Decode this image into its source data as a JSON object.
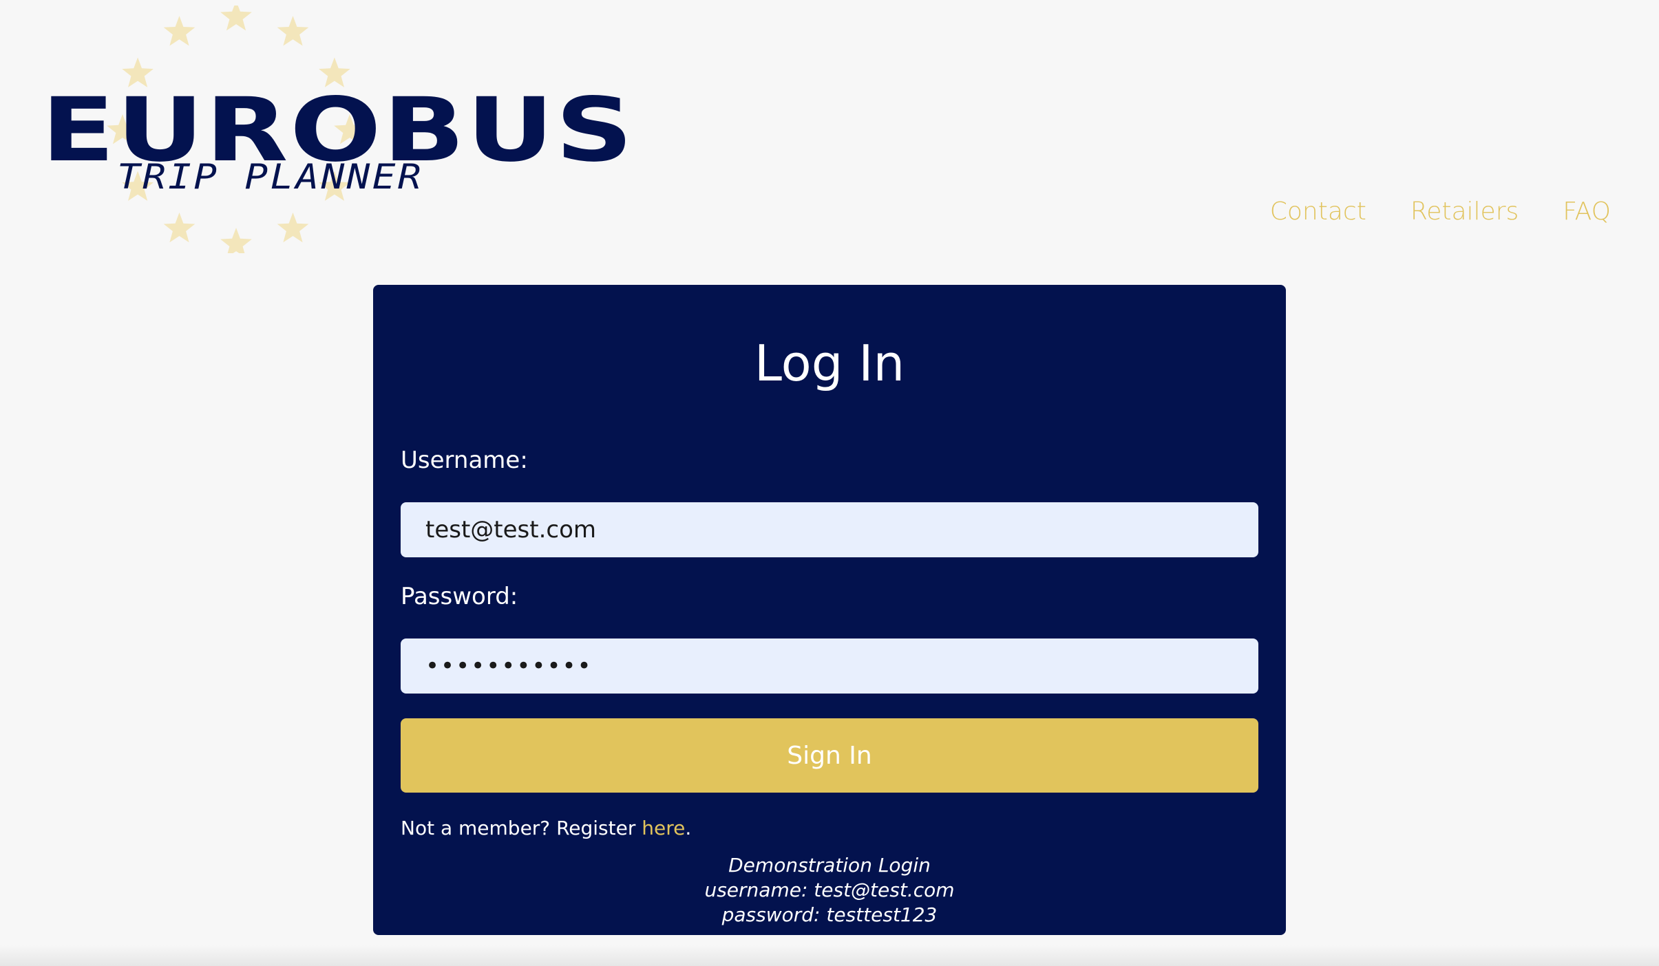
{
  "logo": {
    "title": "EUROBUS",
    "subtitle": "TRIP PLANNER",
    "star_color": "#f3e6bb"
  },
  "nav": {
    "items": [
      {
        "label": "Contact"
      },
      {
        "label": "Retailers"
      },
      {
        "label": "FAQ"
      }
    ],
    "color": "#e1c35c"
  },
  "login": {
    "title": "Log In",
    "username_label": "Username:",
    "username_value": "test@test.com",
    "password_label": "Password:",
    "password_value": "testtest123",
    "signin_label": "Sign In",
    "register_prefix": "Not a member? Register ",
    "register_link": "here",
    "register_suffix": ".",
    "demo_title": "Demonstration Login",
    "demo_username": "username: test@test.com",
    "demo_password": "password: testtest123"
  },
  "colors": {
    "card_bg": "#03124e",
    "accent": "#e1c45c",
    "input_bg": "#e8effd",
    "page_bg": "#f7f7f7"
  }
}
